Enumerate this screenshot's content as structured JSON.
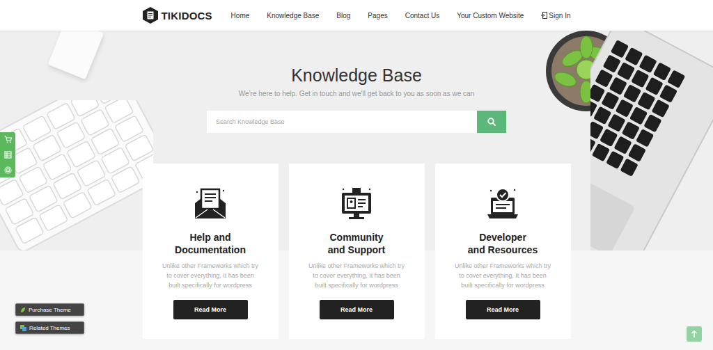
{
  "header": {
    "logo": "TIKIDOCS",
    "nav": [
      {
        "label": "Home"
      },
      {
        "label": "Knowledge Base"
      },
      {
        "label": "Blog"
      },
      {
        "label": "Pages"
      },
      {
        "label": "Contact Us"
      },
      {
        "label": "Your Custom Website"
      }
    ],
    "sign_in": "Sign In"
  },
  "hero": {
    "title": "Knowledge Base",
    "subtitle": "We're here to help. Get in touch and we'll get back to you as soon as we can",
    "search": {
      "placeholder": "Search Knowledge Base"
    }
  },
  "cards": [
    {
      "title_lines": [
        "Help and",
        "Documentation"
      ],
      "description_lines": [
        "Unlike other Frameworks which try",
        "to cover everything, It has been",
        "built specifically for wordpress"
      ],
      "button": "Read More"
    },
    {
      "title_lines": [
        "Community",
        "and Support"
      ],
      "description_lines": [
        "Unlike other Frameworks which try",
        "to cover everything, It has been",
        "built specifically for wordpress"
      ],
      "button": "Read More"
    },
    {
      "title_lines": [
        "Developer",
        "and Resources"
      ],
      "description_lines": [
        "Unlike other Frameworks which try",
        "to cover everything, It has been",
        "built specifically for wordpress"
      ],
      "button": "Read More"
    }
  ],
  "floating_buttons": [
    "Purchase Theme",
    "Related Themes"
  ]
}
